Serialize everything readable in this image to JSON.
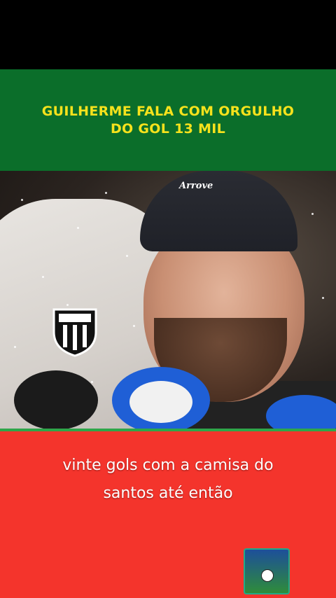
{
  "headline": {
    "line1": "GUILHERME FALA COM ORGULHO",
    "line2": "DO GOL 13 MIL"
  },
  "cap": {
    "logo_text": "Arrove"
  },
  "subtitle": {
    "line1": "vinte gols com a camisa do",
    "line2": "santos até então"
  },
  "colors": {
    "banner_green": "#0b6e2a",
    "headline_yellow": "#f6e21c",
    "bottom_red": "#f4342c"
  },
  "icons": {
    "club_badge": "santos-crest-icon",
    "channel": "channel-logo-icon"
  }
}
